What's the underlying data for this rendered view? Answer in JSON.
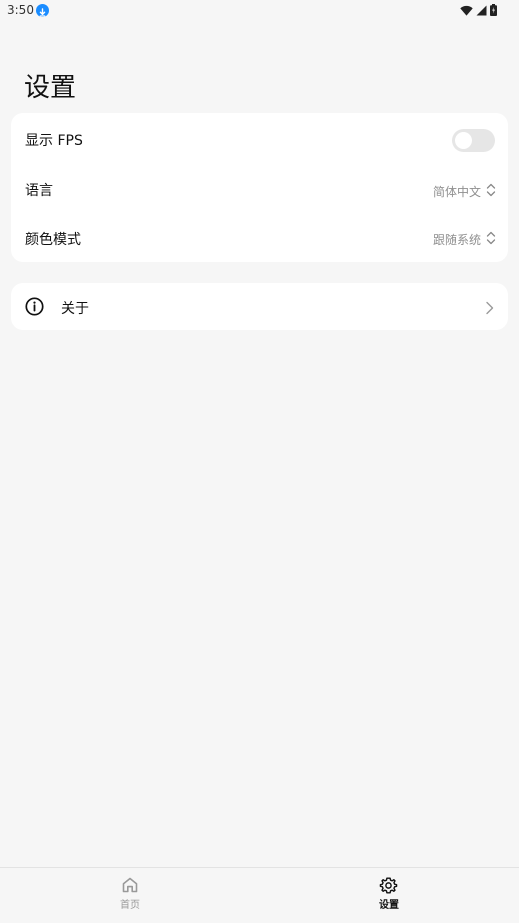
{
  "status_bar": {
    "time": "3:50",
    "download_icon": "download-icon",
    "wifi_icon": "wifi-icon",
    "signal_icon": "cell-signal-icon",
    "battery_icon": "battery-icon"
  },
  "header": {
    "title": "设置"
  },
  "settings_card": {
    "fps": {
      "label": "显示 FPS",
      "enabled": false
    },
    "language": {
      "label": "语言",
      "value": "简体中文",
      "icon": "chevron-up-down-icon"
    },
    "color_mode": {
      "label": "颜色模式",
      "value": "跟随系统",
      "icon": "chevron-up-down-icon"
    }
  },
  "about_card": {
    "label": "关于",
    "icon": "info-icon",
    "chevron": "chevron-right-icon"
  },
  "bottom_nav": {
    "items": [
      {
        "label": "首页",
        "icon": "home-icon",
        "active": false
      },
      {
        "label": "设置",
        "icon": "gear-icon",
        "active": true
      }
    ]
  },
  "colors": {
    "background": "#f6f6f6",
    "card": "#ffffff",
    "toggle_off": "#e6e6e6",
    "secondary_text": "#8f8f8f",
    "download_badge": "#1a8cff"
  }
}
